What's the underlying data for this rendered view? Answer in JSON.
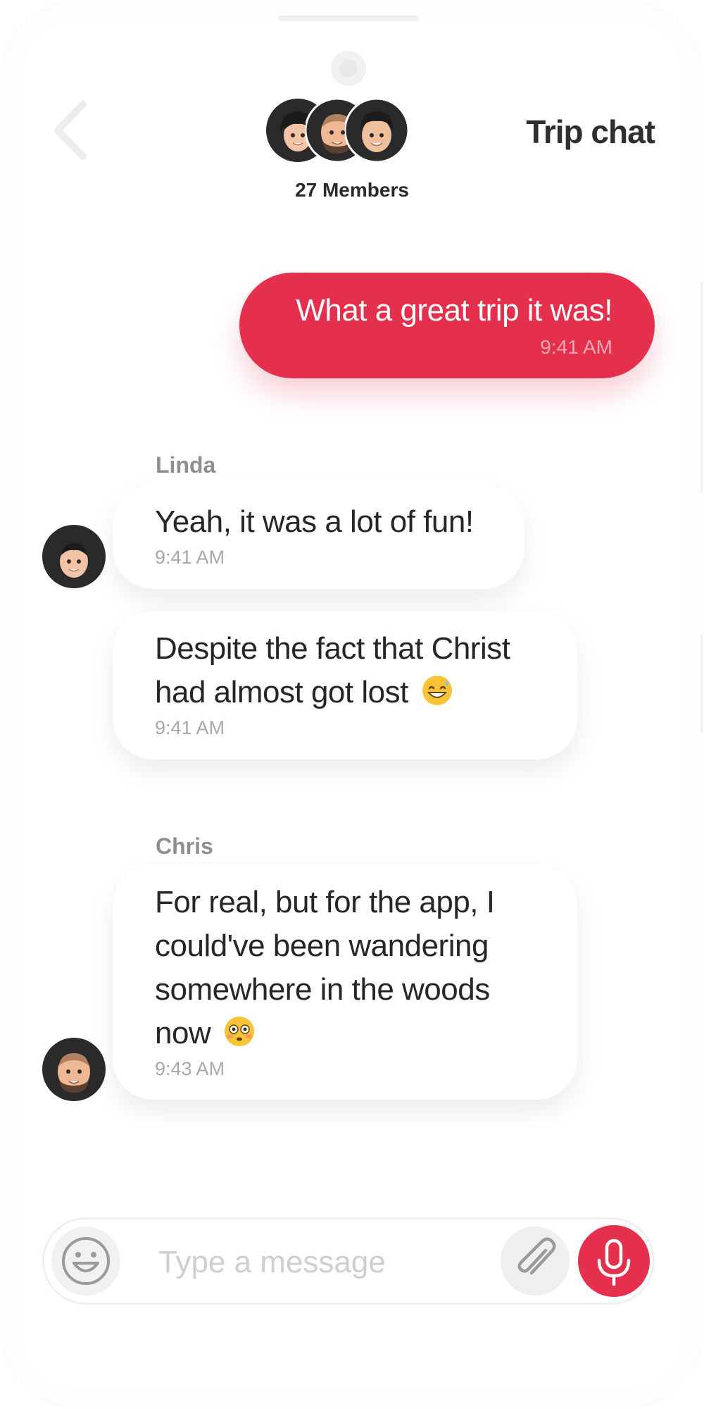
{
  "header": {
    "title": "Trip chat",
    "members_label": "27 Members",
    "back_icon": "chevron-left-icon"
  },
  "messages": {
    "outgoing": {
      "text": "What a great trip it was!",
      "time": "9:41 AM"
    },
    "linda": {
      "sender": "Linda",
      "items": [
        {
          "text": "Yeah, it was a lot of fun!",
          "time": "9:41 AM"
        },
        {
          "text_line1": "Despite the fact that Christ",
          "text_line2": "had almost got lost",
          "emoji": "grinning-sweat-emoji",
          "time": "9:41 AM"
        }
      ]
    },
    "chris": {
      "sender": "Chris",
      "text_line1": "For real, but for the app, I",
      "text_line2": "could've been wandering",
      "text_line3": "somewhere in the woods",
      "text_line4": "now",
      "emoji": "flushed-face-emoji",
      "time": "9:43 AM"
    }
  },
  "composer": {
    "placeholder": "Type a message",
    "emoji_icon": "smiley-icon",
    "attach_icon": "paperclip-icon",
    "mic_icon": "microphone-icon"
  },
  "colors": {
    "accent": "#e4304c",
    "bubble_bg": "#ffffff",
    "time_text": "#a8a8a8"
  }
}
